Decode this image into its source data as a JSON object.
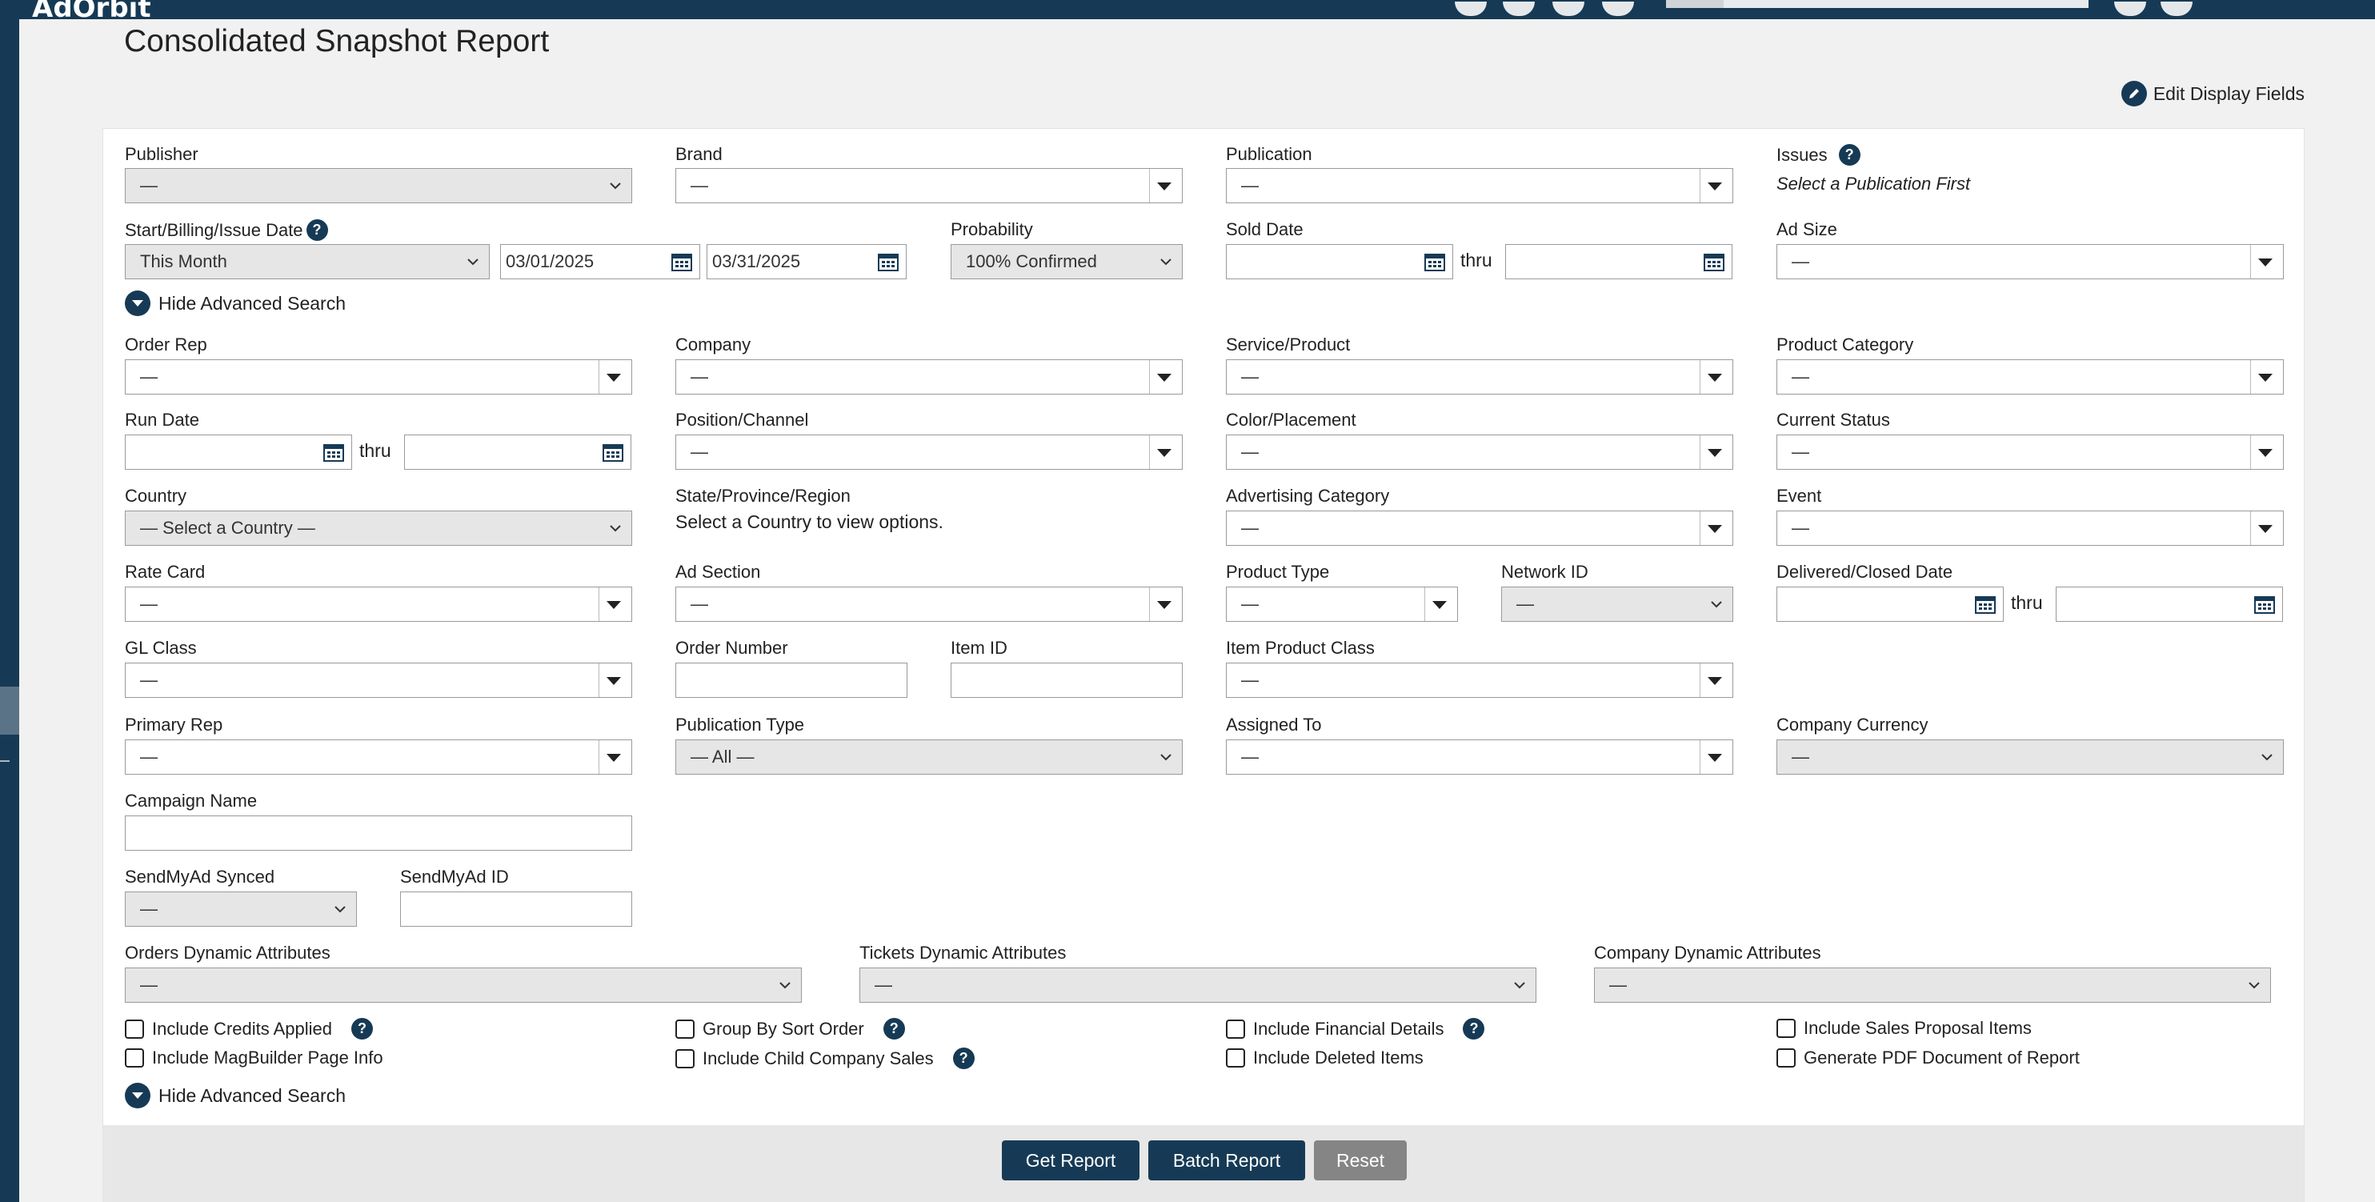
{
  "app": {
    "logo": "AdOrbit"
  },
  "page": {
    "title": "Consolidated Snapshot Report",
    "edit_display_fields": "Edit Display Fields"
  },
  "fields": {
    "publisher": {
      "label": "Publisher",
      "value": "—"
    },
    "brand": {
      "label": "Brand",
      "value": "—"
    },
    "publication": {
      "label": "Publication",
      "value": "—"
    },
    "issues": {
      "label": "Issues",
      "note": "Select a Publication First"
    },
    "start_date": {
      "label": "Start/Billing/Issue Date",
      "range": "This Month",
      "from": "03/01/2025",
      "to": "03/31/2025"
    },
    "probability": {
      "label": "Probability",
      "value": "100% Confirmed"
    },
    "sold_date": {
      "label": "Sold Date",
      "from": "",
      "to": ""
    },
    "ad_size": {
      "label": "Ad Size",
      "value": "—"
    },
    "order_rep": {
      "label": "Order Rep",
      "value": "—"
    },
    "company": {
      "label": "Company",
      "value": "—"
    },
    "service_product": {
      "label": "Service/Product",
      "value": "—"
    },
    "product_category": {
      "label": "Product Category",
      "value": "—"
    },
    "run_date": {
      "label": "Run Date",
      "from": "",
      "to": ""
    },
    "position_channel": {
      "label": "Position/Channel",
      "value": "—"
    },
    "color_placement": {
      "label": "Color/Placement",
      "value": "—"
    },
    "current_status": {
      "label": "Current Status",
      "value": "—"
    },
    "country": {
      "label": "Country",
      "value": "— Select a Country —"
    },
    "state": {
      "label": "State/Province/Region",
      "note": "Select a Country to view options."
    },
    "advertising_category": {
      "label": "Advertising Category",
      "value": "—"
    },
    "event": {
      "label": "Event",
      "value": "—"
    },
    "rate_card": {
      "label": "Rate Card",
      "value": "—"
    },
    "ad_section": {
      "label": "Ad Section",
      "value": "—"
    },
    "product_type": {
      "label": "Product Type",
      "value": "—"
    },
    "network_id": {
      "label": "Network ID",
      "value": "—"
    },
    "delivered_date": {
      "label": "Delivered/Closed Date",
      "from": "",
      "to": ""
    },
    "gl_class": {
      "label": "GL Class",
      "value": "—"
    },
    "order_number": {
      "label": "Order Number",
      "value": ""
    },
    "item_id": {
      "label": "Item ID",
      "value": ""
    },
    "item_product_class": {
      "label": "Item Product Class",
      "value": "—"
    },
    "primary_rep": {
      "label": "Primary Rep",
      "value": "—"
    },
    "publication_type": {
      "label": "Publication Type",
      "value": "— All —"
    },
    "assigned_to": {
      "label": "Assigned To",
      "value": "—"
    },
    "company_currency": {
      "label": "Company Currency",
      "value": "—"
    },
    "campaign_name": {
      "label": "Campaign Name",
      "value": ""
    },
    "sendmyad_synced": {
      "label": "SendMyAd Synced",
      "value": "—"
    },
    "sendmyad_id": {
      "label": "SendMyAd ID",
      "value": ""
    },
    "orders_dynamic": {
      "label": "Orders Dynamic Attributes",
      "value": "—"
    },
    "tickets_dynamic": {
      "label": "Tickets Dynamic Attributes",
      "value": "—"
    },
    "company_dynamic": {
      "label": "Company Dynamic Attributes",
      "value": "—"
    }
  },
  "thru": "thru",
  "advanced_toggle": "Hide Advanced Search",
  "checkboxes": {
    "credits_applied": "Include Credits Applied",
    "group_by_sort": "Group By Sort Order",
    "financial_details": "Include Financial Details",
    "sales_proposal": "Include Sales Proposal Items",
    "magbuilder": "Include MagBuilder Page Info",
    "child_company": "Include Child Company Sales",
    "deleted_items": "Include Deleted Items",
    "generate_pdf": "Generate PDF Document of Report"
  },
  "buttons": {
    "get_report": "Get Report",
    "batch_report": "Batch Report",
    "reset": "Reset"
  },
  "colors": {
    "brand": "#163a55",
    "reset": "#858585",
    "footer": "#e7e7e7"
  },
  "icons": [
    "pencil-icon",
    "help-icon",
    "calendar-icon",
    "chevron-down-icon",
    "caret-down-icon",
    "collapse-circle-icon"
  ]
}
